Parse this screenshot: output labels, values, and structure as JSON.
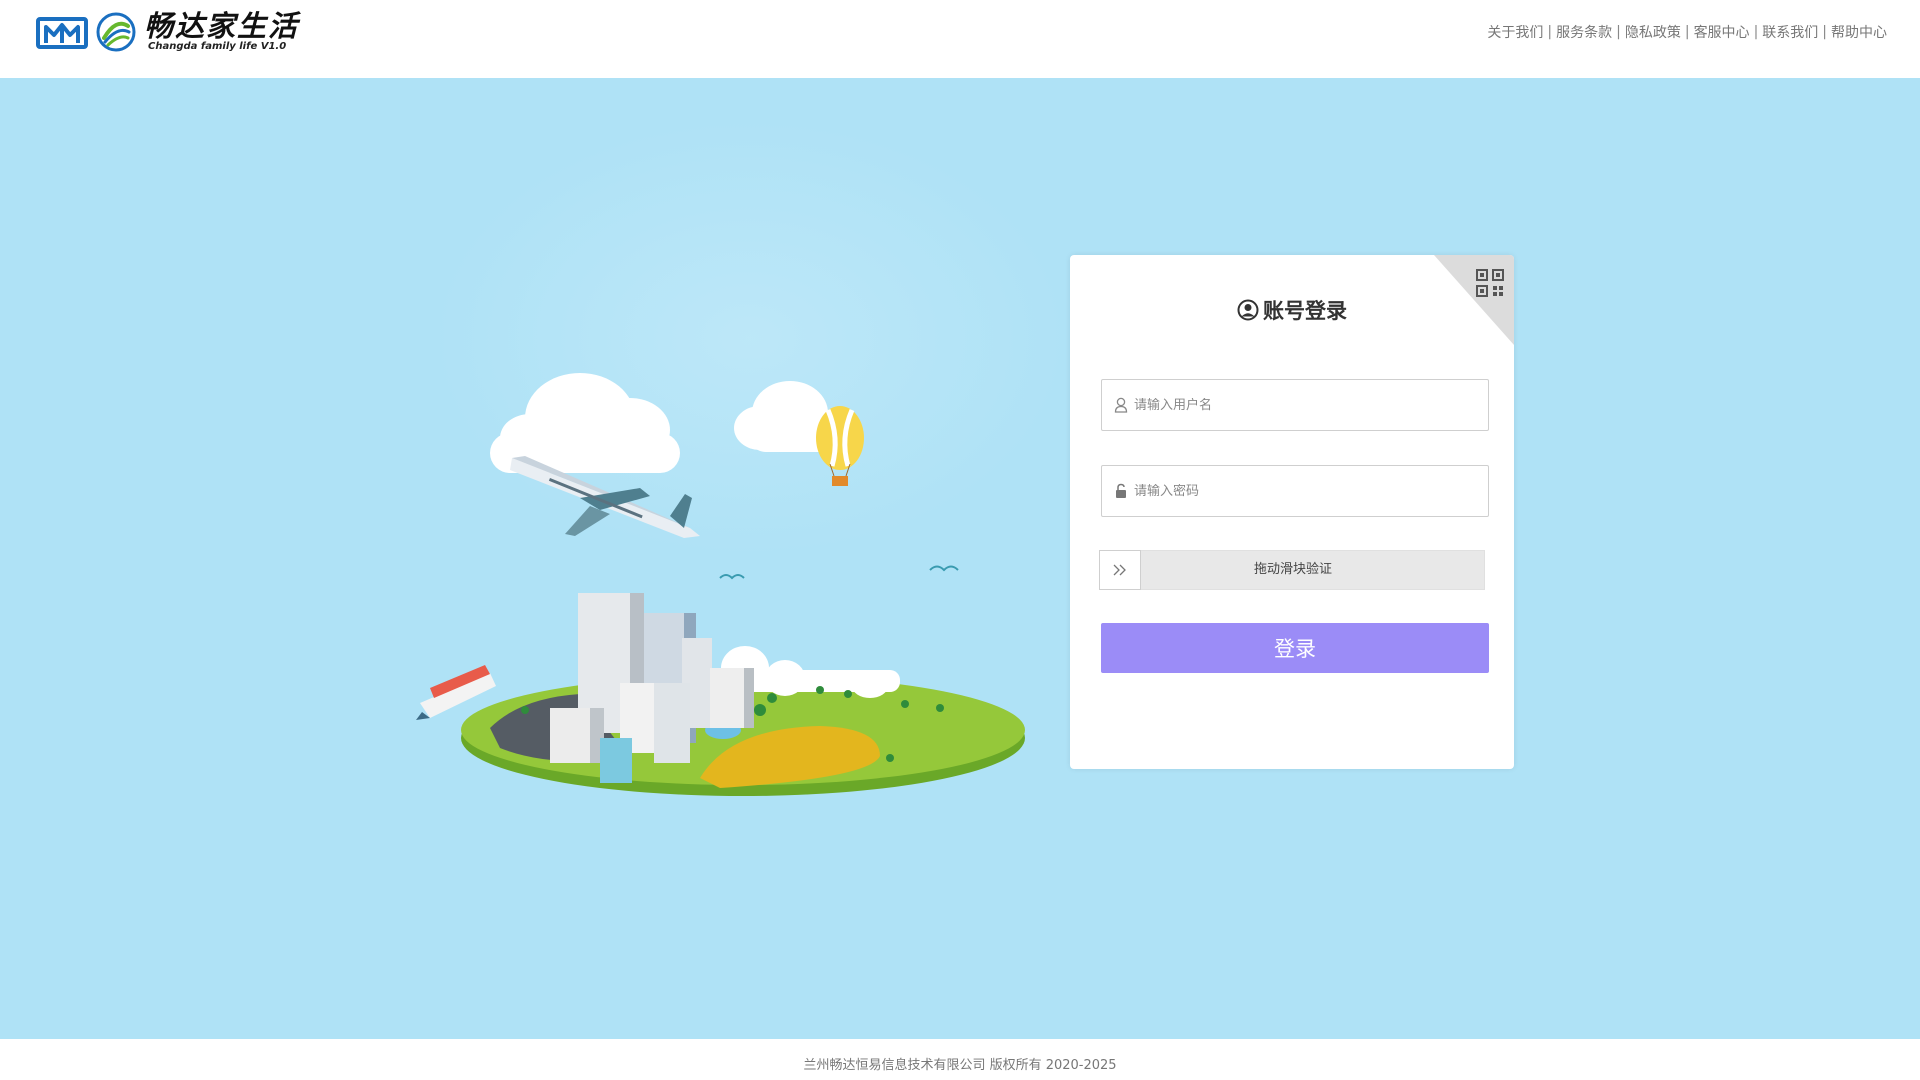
{
  "header": {
    "logo_title": "畅达家生活",
    "logo_subtitle": "Changda family life V1.0",
    "links": [
      {
        "label": "关于我们"
      },
      {
        "label": "服务条款"
      },
      {
        "label": "隐私政策"
      },
      {
        "label": "客服中心"
      },
      {
        "label": "联系我们"
      },
      {
        "label": "帮助中心"
      }
    ],
    "separator": "|"
  },
  "login": {
    "title": "账号登录",
    "username_placeholder": "请输入用户名",
    "username_value": "",
    "password_placeholder": "请输入密码",
    "password_value": "",
    "slider_text": "拖动滑块验证",
    "submit_label": "登录"
  },
  "footer": {
    "copyright": "兰州畅达恒易信息技术有限公司 版权所有 2020-2025"
  },
  "colors": {
    "background": "#afe2f6",
    "login_button": "#9b8cf7",
    "logo_blue": "#1a6fc0",
    "logo_green": "#66b82e"
  },
  "icons": {
    "qr": "qr-code-icon",
    "user": "user-circle-icon",
    "username_field": "person-icon",
    "password_field": "lock-icon",
    "slider": "double-chevron-right-icon"
  }
}
